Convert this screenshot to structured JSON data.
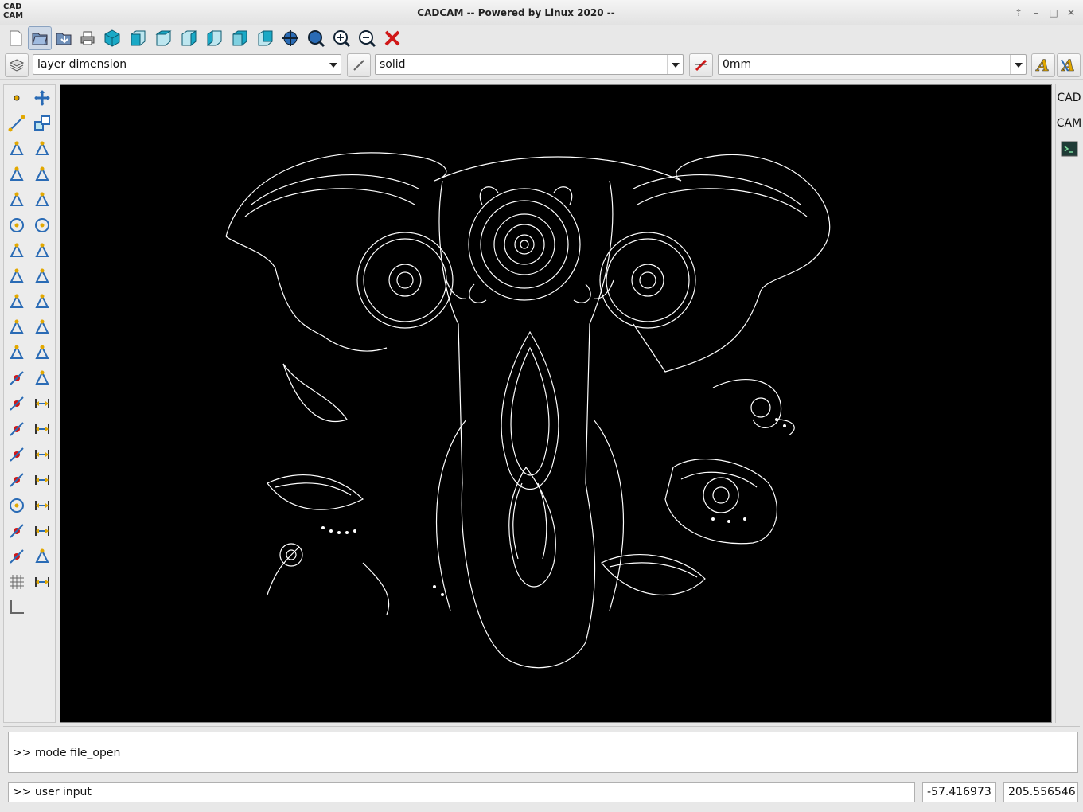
{
  "window": {
    "logo_line1": "CAD",
    "logo_line2": "CAM",
    "title": "CADCAM -- Powered by Linux 2020 --"
  },
  "toolbar_main": {
    "icons": [
      "new-file-icon",
      "open-file-icon",
      "save-file-icon",
      "print-icon",
      "view-3d-icon",
      "view-front-icon",
      "view-top-icon",
      "view-right-icon",
      "view-left-icon",
      "view-bottom-icon",
      "view-back-icon",
      "zoom-extents-icon",
      "zoom-window-icon",
      "zoom-in-icon",
      "zoom-out-icon",
      "close-icon"
    ],
    "active_icon": "open-file-icon"
  },
  "toolbar_properties": {
    "layer": "layer dimension",
    "linetype": "solid",
    "lineweight": "0mm"
  },
  "left_tools": [
    "point-tool-icon",
    "move-tool-icon",
    "line-tool-icon",
    "copy-tool-icon",
    "polyline-tool-icon",
    "offset-tool-icon",
    "rectangle-tool-icon",
    "stretch-tool-icon",
    "spline-tool-icon",
    "mirror-tool-icon",
    "circle-tool-icon",
    "rotate-tool-icon",
    "arc-3pt-tool-icon",
    "scale-tool-icon",
    "polygon-tool-icon",
    "trim-tool-icon",
    "ellipse-tool-icon",
    "break-tool-icon",
    "bezier-tool-icon",
    "fillet-tool-icon",
    "nurbs-tool-icon",
    "chamfer-tool-icon",
    "snap-endpoint-icon",
    "hatch-tool-icon",
    "snap-midpoint-icon",
    "dim-linear-icon",
    "snap-intersection-icon",
    "dim-vertical-icon",
    "snap-perpendicular-icon",
    "dim-aligned-icon",
    "snap-nearest-icon",
    "dim-diameter-icon",
    "snap-center-icon",
    "dim-radius-icon",
    "snap-tangent-icon",
    "dim-angle-icon",
    "snap-quadrant-icon",
    "leader-tool-icon",
    "grid-snap-icon",
    "measure-tool-icon",
    "ortho-mode-icon"
  ],
  "right_tabs": [
    "CAD",
    "CAM"
  ],
  "console": {
    "output": ">> mode file_open",
    "input": ">> user input",
    "coord_x": "-57.416973",
    "coord_y": "205.556546"
  },
  "colors": {
    "canvas_background": "#000000",
    "drawing_stroke": "#ffffff",
    "accent_blue": "#2a6bb5",
    "accent_cyan": "#1aa9c6"
  }
}
